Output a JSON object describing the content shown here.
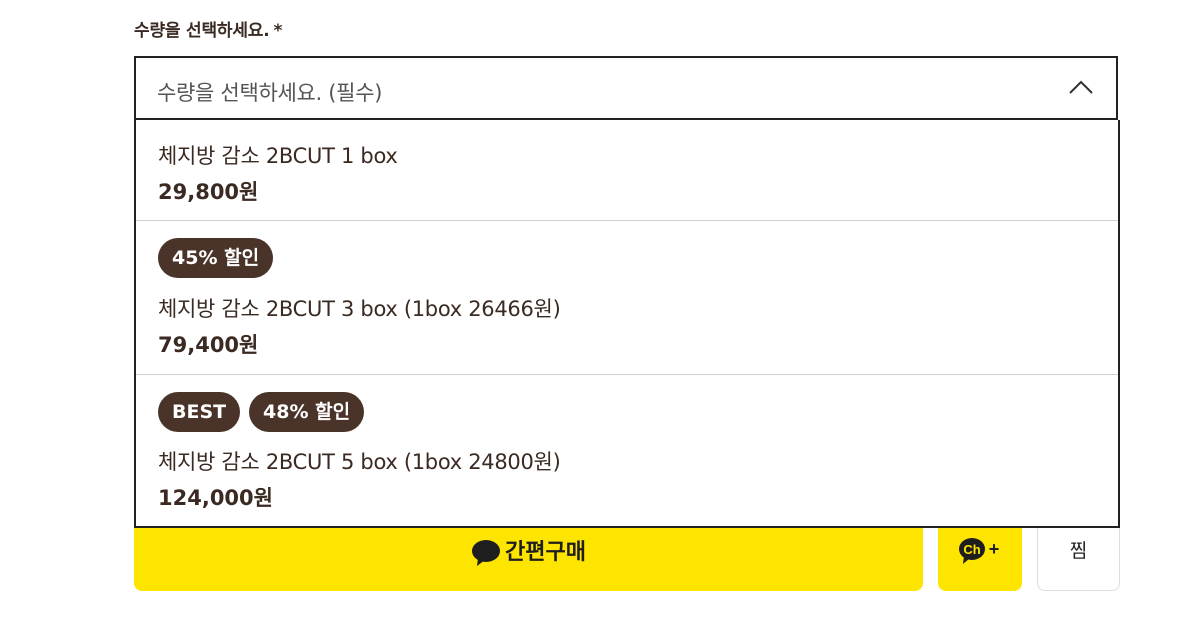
{
  "field": {
    "label": "수량을 선택하세요.",
    "required_mark": "*"
  },
  "select": {
    "value": "수량을 선택하세요. (필수)",
    "state": "open",
    "icon": "chevron-up-icon"
  },
  "options": [
    {
      "name": "체지방 감소 2BCUT 1 box",
      "price": "29,800원",
      "badges": []
    },
    {
      "name": "체지방 감소 2BCUT 3 box (1box 26466원)",
      "price": "79,400원",
      "badges": [
        "45% 할인"
      ]
    },
    {
      "name": "체지방 감소 2BCUT 5 box (1box 24800원)",
      "price": "124,000원",
      "badges": [
        "BEST",
        "48% 할인"
      ]
    }
  ],
  "actions": {
    "buy_label": "간편구매",
    "channel_icon": "kakao-channel-add-icon",
    "wish_label": "찜"
  },
  "colors": {
    "brand_yellow": "#fee500",
    "badge_brown": "#4a3328",
    "text_brown": "#3a2a22"
  }
}
